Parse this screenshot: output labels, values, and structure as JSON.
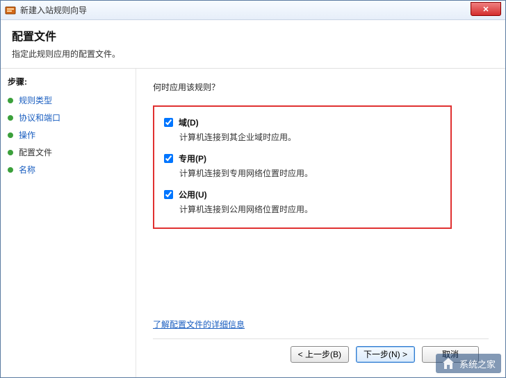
{
  "window": {
    "title": "新建入站规则向导"
  },
  "header": {
    "title": "配置文件",
    "subtitle": "指定此规则应用的配置文件。"
  },
  "sidebar": {
    "heading": "步骤:",
    "items": [
      {
        "label": "规则类型"
      },
      {
        "label": "协议和端口"
      },
      {
        "label": "操作"
      },
      {
        "label": "配置文件"
      },
      {
        "label": "名称"
      }
    ],
    "current_index": 3
  },
  "main": {
    "prompt": "何时应用该规则？",
    "options": [
      {
        "label": "域(D)",
        "desc": "计算机连接到其企业域时应用。",
        "checked": true
      },
      {
        "label": "专用(P)",
        "desc": "计算机连接到专用网络位置时应用。",
        "checked": true
      },
      {
        "label": "公用(U)",
        "desc": "计算机连接到公用网络位置时应用。",
        "checked": true
      }
    ],
    "more_info": "了解配置文件的详细信息"
  },
  "footer": {
    "back": "< 上一步(B)",
    "next": "下一步(N) >",
    "cancel": "取消"
  },
  "watermark": {
    "text": "系统之家",
    "url_hint": "xitongzhijia"
  }
}
